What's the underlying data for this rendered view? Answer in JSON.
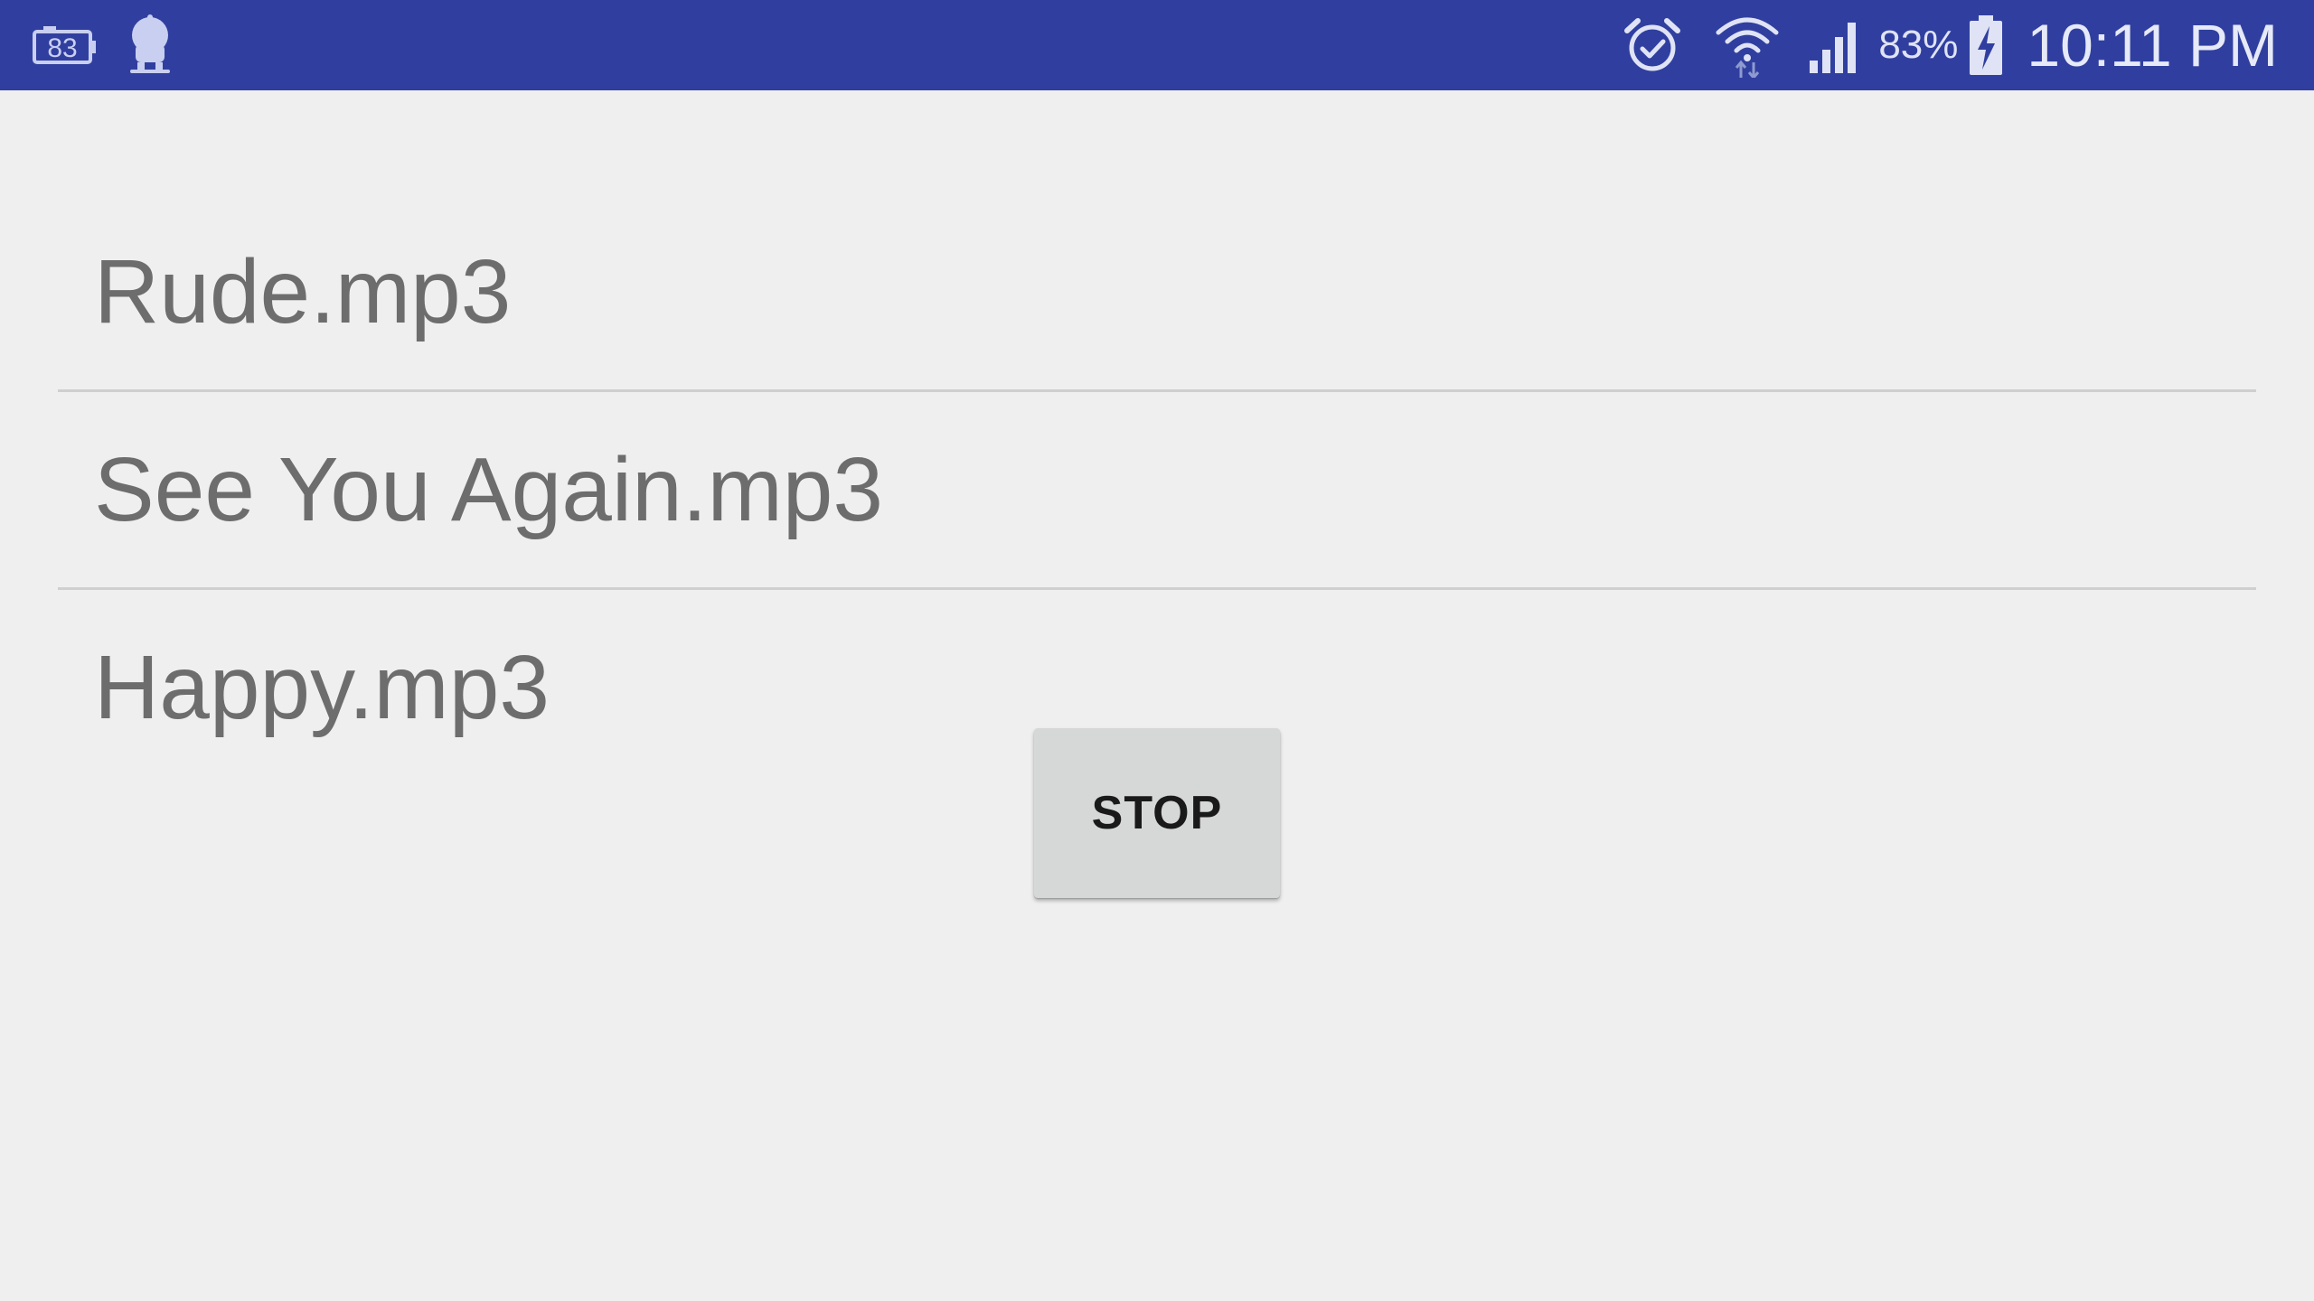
{
  "status_bar": {
    "left_icons": [
      "photo-counter-icon",
      "app-mascot-icon"
    ],
    "photo_counter_text": "83",
    "right_icons": [
      "alarm-icon",
      "wifi-icon",
      "signal-icon",
      "battery-charging-icon"
    ],
    "battery_percent": "83%",
    "time": "10:11 PM",
    "background_color": "#303f9f"
  },
  "songs": [
    {
      "title": "Rude.mp3"
    },
    {
      "title": "See You Again.mp3"
    },
    {
      "title": "Happy.mp3"
    }
  ],
  "controls": {
    "stop_label": "STOP"
  },
  "colors": {
    "background": "#efefef",
    "song_text": "#6d6d6d",
    "divider": "#cfcfcf",
    "button_background": "#d6d7d7"
  }
}
